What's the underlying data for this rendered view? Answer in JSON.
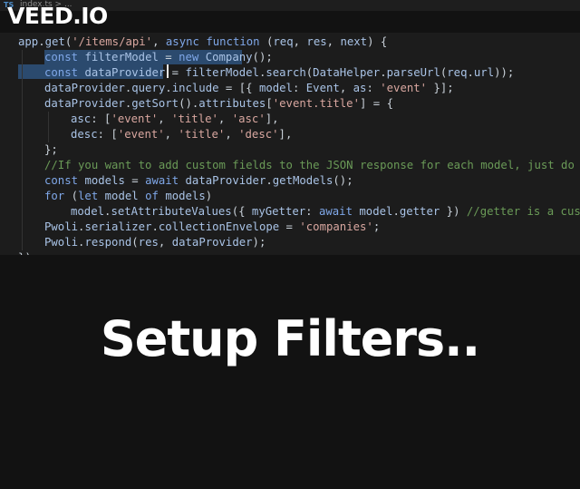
{
  "tab": {
    "icon": "TS",
    "breadcrumb": "index.ts > ..."
  },
  "logo": "VEED.IO",
  "code": [
    {
      "indent": 0,
      "text": "app.get('/items/api', async function (req, res, next) {"
    },
    {
      "indent": 1,
      "text": "const filterModel = new Company();"
    },
    {
      "indent": 1,
      "text": "const dataProvider = filterModel.search(DataHelper.parseUrl(req.url));"
    },
    {
      "indent": 1,
      "text": "dataProvider.query.include = [{ model: Event, as: 'event' }];"
    },
    {
      "indent": 1,
      "text": "dataProvider.getSort().attributes['event.title'] = {"
    },
    {
      "indent": 2,
      "text": "asc: ['event', 'title', 'asc'],"
    },
    {
      "indent": 2,
      "text": "desc: ['event', 'title', 'desc'],"
    },
    {
      "indent": 1,
      "text": "};"
    },
    {
      "indent": 1,
      "text": "//If you want to add custom fields to the JSON response for each model, just do like"
    },
    {
      "indent": 1,
      "text": "const models = await dataProvider.getModels();"
    },
    {
      "indent": 1,
      "text": "for (let model of models)"
    },
    {
      "indent": 2,
      "text": "model.setAttributeValues({ myGetter: await model.getter }) //getter is a custom"
    },
    {
      "indent": 1,
      "text": "Pwoli.serializer.collectionEnvelope = 'companies';"
    },
    {
      "indent": 1,
      "text": "Pwoli.respond(res, dataProvider);"
    },
    {
      "indent": 0,
      "text": "});"
    }
  ],
  "caption": "Setup Filters..",
  "colors": {
    "background": "#121212",
    "editor": "#1c1c1c",
    "selection": "#2b4a6e",
    "string": "#d9a7a0",
    "keyword": "#7fa7e8",
    "comment": "#6a9a57"
  }
}
